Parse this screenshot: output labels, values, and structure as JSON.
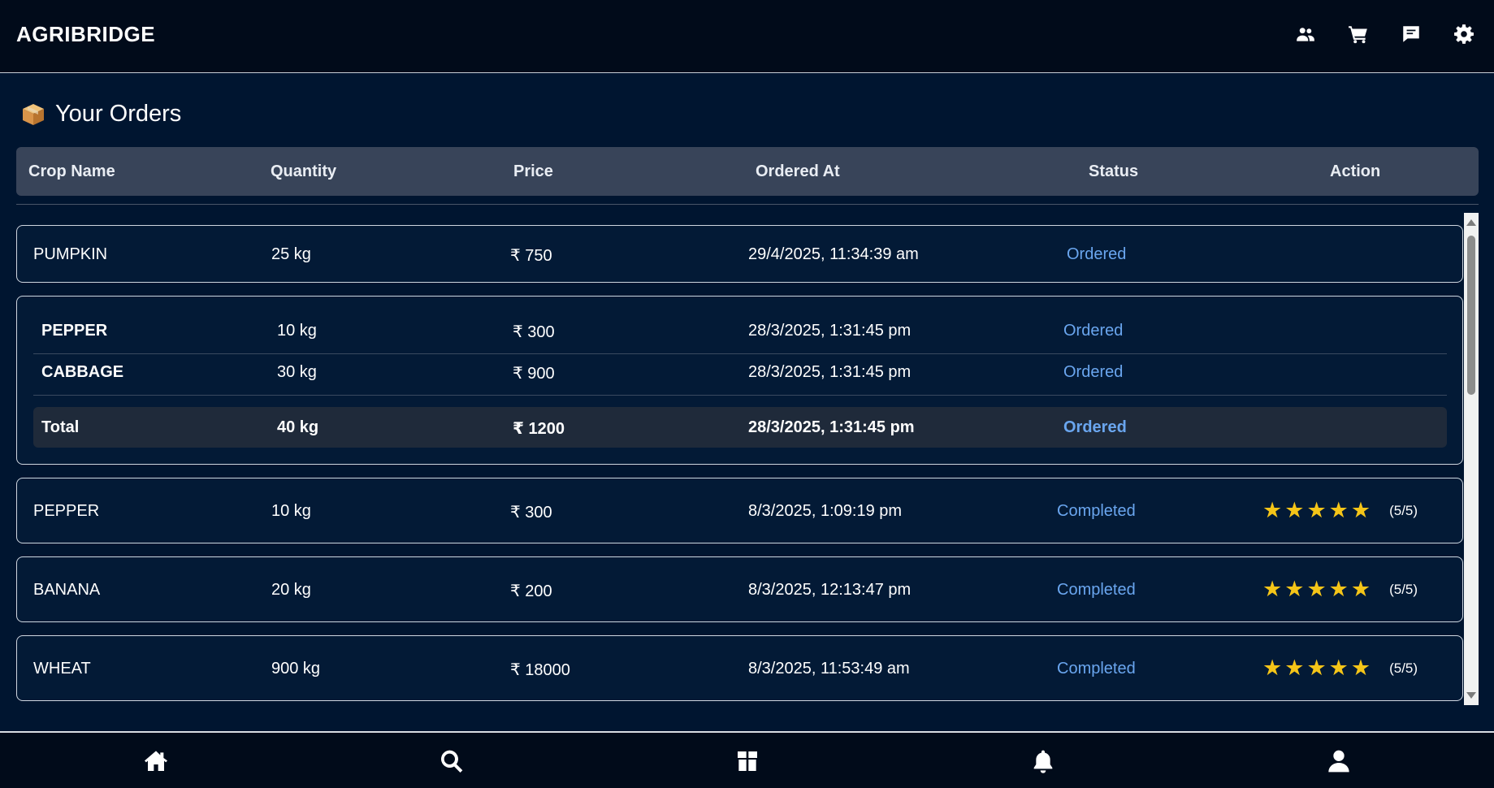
{
  "app": {
    "brand": "AGRIBRIDGE"
  },
  "header_icons": [
    "users-icon",
    "cart-icon",
    "chat-icon",
    "gear-icon"
  ],
  "page": {
    "title": "Your Orders",
    "title_icon": "package-icon"
  },
  "table": {
    "columns": [
      "Crop Name",
      "Quantity",
      "Price",
      "Ordered At",
      "Status",
      "Action"
    ]
  },
  "orders": [
    {
      "crop": "PUMPKIN",
      "quantity": "25 kg",
      "price": "₹ 750",
      "ordered_at": "29/4/2025, 11:34:39 am",
      "status": "Ordered"
    },
    {
      "group_items": [
        {
          "crop": "PEPPER",
          "quantity": "10 kg",
          "price": "₹ 300",
          "ordered_at": "28/3/2025, 1:31:45 pm",
          "status": "Ordered"
        },
        {
          "crop": "CABBAGE",
          "quantity": "30 kg",
          "price": "₹ 900",
          "ordered_at": "28/3/2025, 1:31:45 pm",
          "status": "Ordered"
        }
      ],
      "total": {
        "label": "Total",
        "quantity": "40 kg",
        "price": "₹ 1200",
        "ordered_at": "28/3/2025, 1:31:45 pm",
        "status": "Ordered"
      }
    },
    {
      "crop": "PEPPER",
      "quantity": "10 kg",
      "price": "₹ 300",
      "ordered_at": "8/3/2025, 1:09:19 pm",
      "status": "Completed",
      "rating": 5,
      "rating_text": "(5/5)"
    },
    {
      "crop": "BANANA",
      "quantity": "20 kg",
      "price": "₹ 200",
      "ordered_at": "8/3/2025, 12:13:47 pm",
      "status": "Completed",
      "rating": 5,
      "rating_text": "(5/5)"
    },
    {
      "crop": "WHEAT",
      "quantity": "900 kg",
      "price": "₹ 18000",
      "ordered_at": "8/3/2025, 11:53:49 am",
      "status": "Completed",
      "rating": 5,
      "rating_text": "(5/5)"
    }
  ],
  "bottom_nav": [
    "home-icon",
    "search-icon",
    "store-icon",
    "bell-icon",
    "profile-icon"
  ],
  "colors": {
    "background": "#001530",
    "status": "#6aa6ef",
    "star": "#f5c518",
    "header_row": "#384459"
  }
}
